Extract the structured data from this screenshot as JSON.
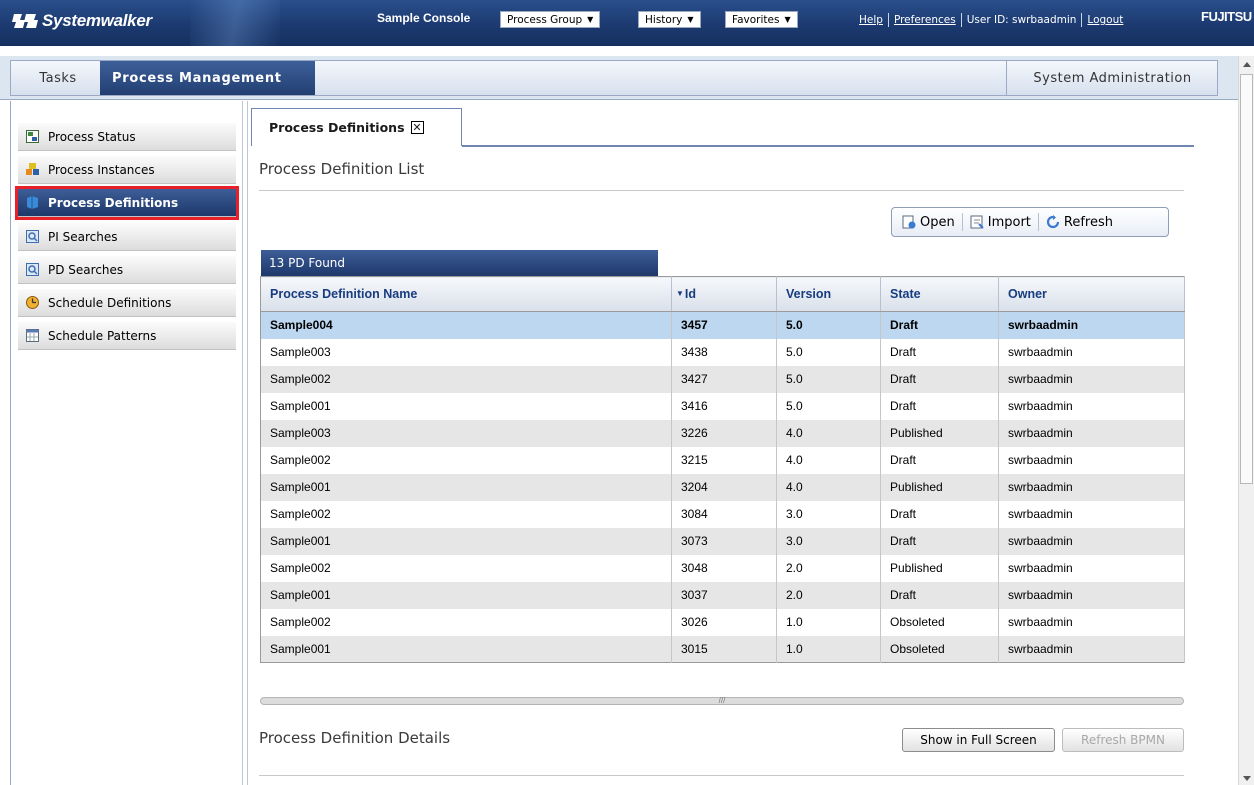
{
  "app": {
    "logo_text": "Systemwalker",
    "console_name": "Sample Console",
    "vendor": "FUJITSU"
  },
  "header": {
    "menus": [
      {
        "label": "Process Group"
      },
      {
        "label": "History"
      },
      {
        "label": "Favorites"
      }
    ],
    "help_label": "Help",
    "preferences_label": "Preferences",
    "user_label": "User ID: swrbaadmin",
    "logout_label": "Logout"
  },
  "tabs": {
    "tasks": "Tasks",
    "process_management": "Process Management",
    "system_administration": "System Administration"
  },
  "sidebar": {
    "items": [
      {
        "label": "Process Status",
        "icon": "process-status-icon"
      },
      {
        "label": "Process Instances",
        "icon": "process-instances-icon"
      },
      {
        "label": "Process Definitions",
        "icon": "process-definitions-icon",
        "selected": true
      },
      {
        "label": "PI Searches",
        "icon": "search-icon"
      },
      {
        "label": "PD Searches",
        "icon": "search-icon"
      },
      {
        "label": "Schedule Definitions",
        "icon": "clock-icon"
      },
      {
        "label": "Schedule Patterns",
        "icon": "calendar-icon"
      }
    ]
  },
  "content": {
    "tab_label": "Process Definitions",
    "list_title": "Process Definition List",
    "toolbar": {
      "open_label": "Open",
      "import_label": "Import",
      "refresh_label": "Refresh"
    },
    "found_label": "13 PD Found",
    "columns": [
      "Process Definition Name",
      "Id",
      "Version",
      "State",
      "Owner"
    ],
    "rows": [
      [
        "Sample004",
        "3457",
        "5.0",
        "Draft",
        "swrbaadmin"
      ],
      [
        "Sample003",
        "3438",
        "5.0",
        "Draft",
        "swrbaadmin"
      ],
      [
        "Sample002",
        "3427",
        "5.0",
        "Draft",
        "swrbaadmin"
      ],
      [
        "Sample001",
        "3416",
        "5.0",
        "Draft",
        "swrbaadmin"
      ],
      [
        "Sample003",
        "3226",
        "4.0",
        "Published",
        "swrbaadmin"
      ],
      [
        "Sample002",
        "3215",
        "4.0",
        "Draft",
        "swrbaadmin"
      ],
      [
        "Sample001",
        "3204",
        "4.0",
        "Published",
        "swrbaadmin"
      ],
      [
        "Sample002",
        "3084",
        "3.0",
        "Draft",
        "swrbaadmin"
      ],
      [
        "Sample001",
        "3073",
        "3.0",
        "Draft",
        "swrbaadmin"
      ],
      [
        "Sample002",
        "3048",
        "2.0",
        "Published",
        "swrbaadmin"
      ],
      [
        "Sample001",
        "3037",
        "2.0",
        "Draft",
        "swrbaadmin"
      ],
      [
        "Sample002",
        "3026",
        "1.0",
        "Obsoleted",
        "swrbaadmin"
      ],
      [
        "Sample001",
        "3015",
        "1.0",
        "Obsoleted",
        "swrbaadmin"
      ]
    ],
    "selected_row": 0,
    "details_title": "Process Definition Details",
    "full_screen_label": "Show in Full Screen",
    "refresh_bpmn_label": "Refresh BPMN"
  },
  "colors": {
    "header_blue": "#1c3a70",
    "selected_blue": "#2a4a80",
    "highlight_red": "#e8202a",
    "row_selected": "#bdd7f0",
    "header_text": "#173c80"
  }
}
